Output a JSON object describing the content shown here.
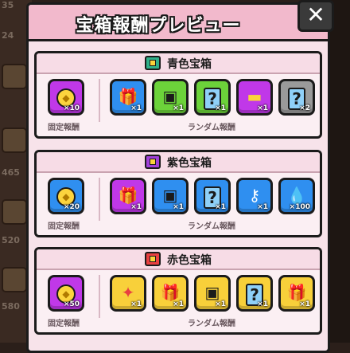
{
  "background": {
    "numbers": [
      "24",
      "35",
      "465",
      "520",
      "580"
    ]
  },
  "dialog": {
    "title": "宝箱報酬プレビュー",
    "close_label": "✕"
  },
  "labels": {
    "fixed": "固定報酬",
    "random": "ランダム報酬"
  },
  "sections": [
    {
      "title": "青色宝箱",
      "chest_color": "#2fb08a",
      "fixed": {
        "icon": "coin-icon",
        "color": "#c038e8",
        "qty": "×10"
      },
      "random": [
        {
          "icon": "gift-icon",
          "color": "#2f8ff0",
          "qty": "×1"
        },
        {
          "icon": "robot-icon",
          "color": "#6cd23a",
          "qty": "×1"
        },
        {
          "icon": "mystery-box-icon",
          "color": "#6cd23a",
          "qty": "×1"
        },
        {
          "icon": "ticket-icon",
          "color": "#c038e8",
          "qty": "×1"
        },
        {
          "icon": "mystery-box-icon",
          "color": "#9a9a9a",
          "qty": "×2"
        }
      ]
    },
    {
      "title": "紫色宝箱",
      "chest_color": "#a040d8",
      "fixed": {
        "icon": "coin-icon",
        "color": "#2f8ff0",
        "qty": "×20"
      },
      "random": [
        {
          "icon": "gift-icon",
          "color": "#c038e8",
          "qty": "×1"
        },
        {
          "icon": "robot-icon",
          "color": "#2f8ff0",
          "qty": "×1"
        },
        {
          "icon": "mystery-box-icon",
          "color": "#2f8ff0",
          "qty": "×1"
        },
        {
          "icon": "key-icon",
          "color": "#2f8ff0",
          "qty": "×1"
        },
        {
          "icon": "drop-icon",
          "color": "#2f8ff0",
          "qty": "×100"
        }
      ]
    },
    {
      "title": "赤色宝箱",
      "chest_color": "#e84040",
      "fixed": {
        "icon": "coin-icon",
        "color": "#c038e8",
        "qty": "×50"
      },
      "random": [
        {
          "icon": "map-icon",
          "color": "#f8d03a",
          "qty": "×1"
        },
        {
          "icon": "gift-icon",
          "color": "#f8d03a",
          "qty": "×1"
        },
        {
          "icon": "robot-icon",
          "color": "#f8d03a",
          "qty": "×1"
        },
        {
          "icon": "mystery-box-icon",
          "color": "#f8d03a",
          "qty": "×1"
        },
        {
          "icon": "gift-icon",
          "color": "#f8d03a",
          "qty": "×1"
        }
      ]
    }
  ]
}
